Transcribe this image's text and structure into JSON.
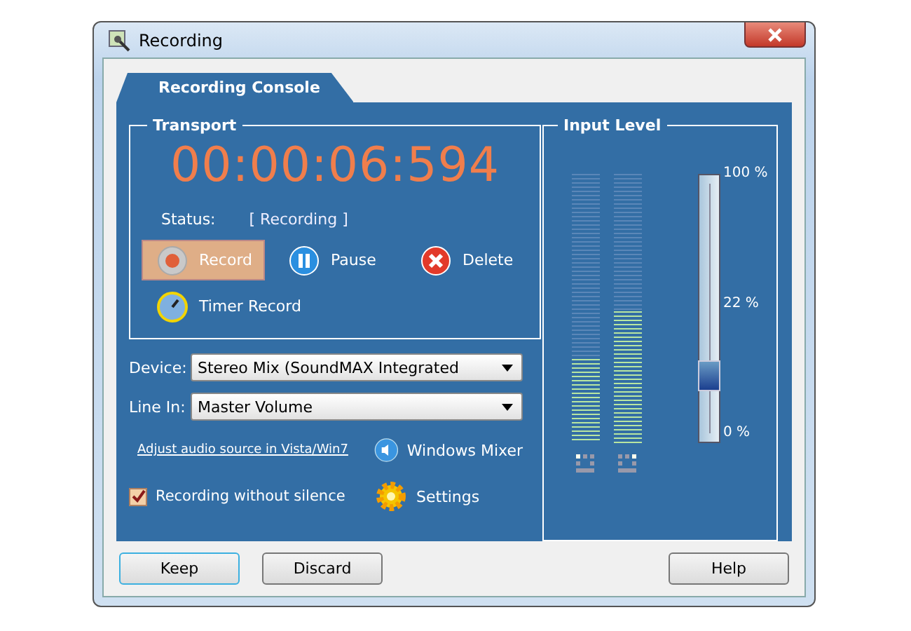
{
  "window": {
    "title": "Recording"
  },
  "tabs": [
    {
      "label": "Recording Console",
      "selected": true
    }
  ],
  "transport": {
    "title": "Transport",
    "time": "00:00:06:594",
    "status_label": "Status:",
    "status_value": "[ Recording ]",
    "actions": [
      {
        "label": "Record",
        "kind": "record",
        "selected": true
      },
      {
        "label": "Pause",
        "kind": "pause",
        "selected": false
      },
      {
        "label": "Delete",
        "kind": "delete",
        "selected": false
      },
      {
        "label": "Timer Record",
        "kind": "timer",
        "selected": false
      }
    ]
  },
  "device": {
    "label": "Device:",
    "value": "Stereo Mix (SoundMAX Integrated"
  },
  "line_in": {
    "label": "Line In:",
    "value": "Master Volume"
  },
  "link": "Adjust audio source in Vista/Win7",
  "windows_mixer": "Windows Mixer",
  "silence": {
    "label": "Recording without silence",
    "checked": true
  },
  "settings": "Settings",
  "input_level": {
    "title": "Input Level",
    "meters": [
      {
        "level": 0.31
      },
      {
        "level": 0.49
      }
    ],
    "slider": {
      "level": 0.25
    },
    "scale": [
      "100 %",
      "22 %",
      "0 %"
    ]
  },
  "buttons": [
    {
      "label": "Keep",
      "selected": true
    },
    {
      "label": "Discard",
      "selected": false
    },
    {
      "label": "Help",
      "selected": false
    }
  ]
}
